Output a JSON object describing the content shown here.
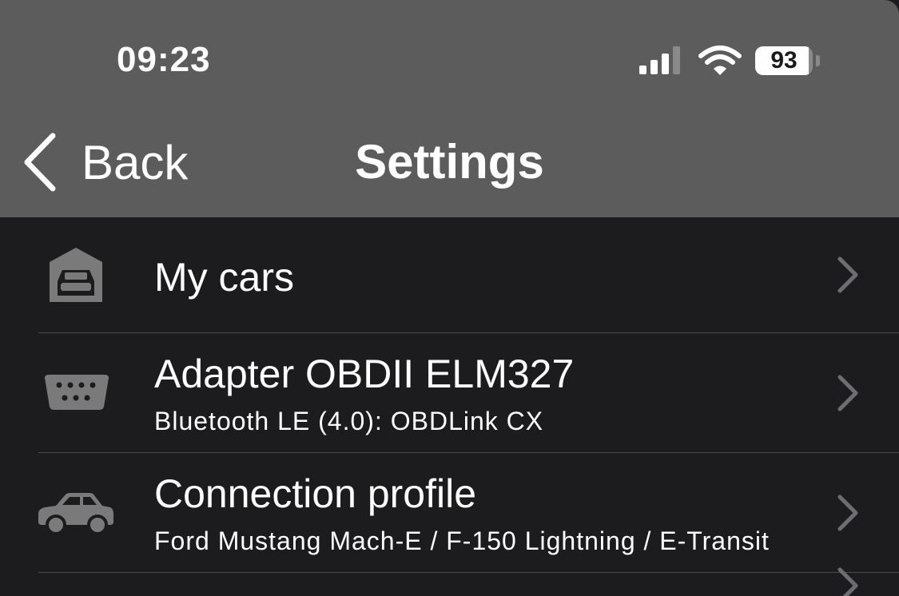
{
  "status": {
    "time": "09:23",
    "battery": "93",
    "battery_level": 0.93
  },
  "nav": {
    "back_label": "Back",
    "title": "Settings"
  },
  "rows": [
    {
      "icon": "garage-car-icon",
      "title": "My cars",
      "subtitle": ""
    },
    {
      "icon": "obd-connector-icon",
      "title": "Adapter OBDII ELM327",
      "subtitle": "Bluetooth LE (4.0): OBDLink CX"
    },
    {
      "icon": "car-icon",
      "title": "Connection profile",
      "subtitle": "Ford Mustang Mach-E / F-150 Lightning / E-Transit"
    }
  ],
  "colors": {
    "topbar": "#5c5c5c",
    "background": "#1c1c1e",
    "icon": "#7a7a7a",
    "chevron": "#6e6e72",
    "separator": "#4a4a4c"
  }
}
